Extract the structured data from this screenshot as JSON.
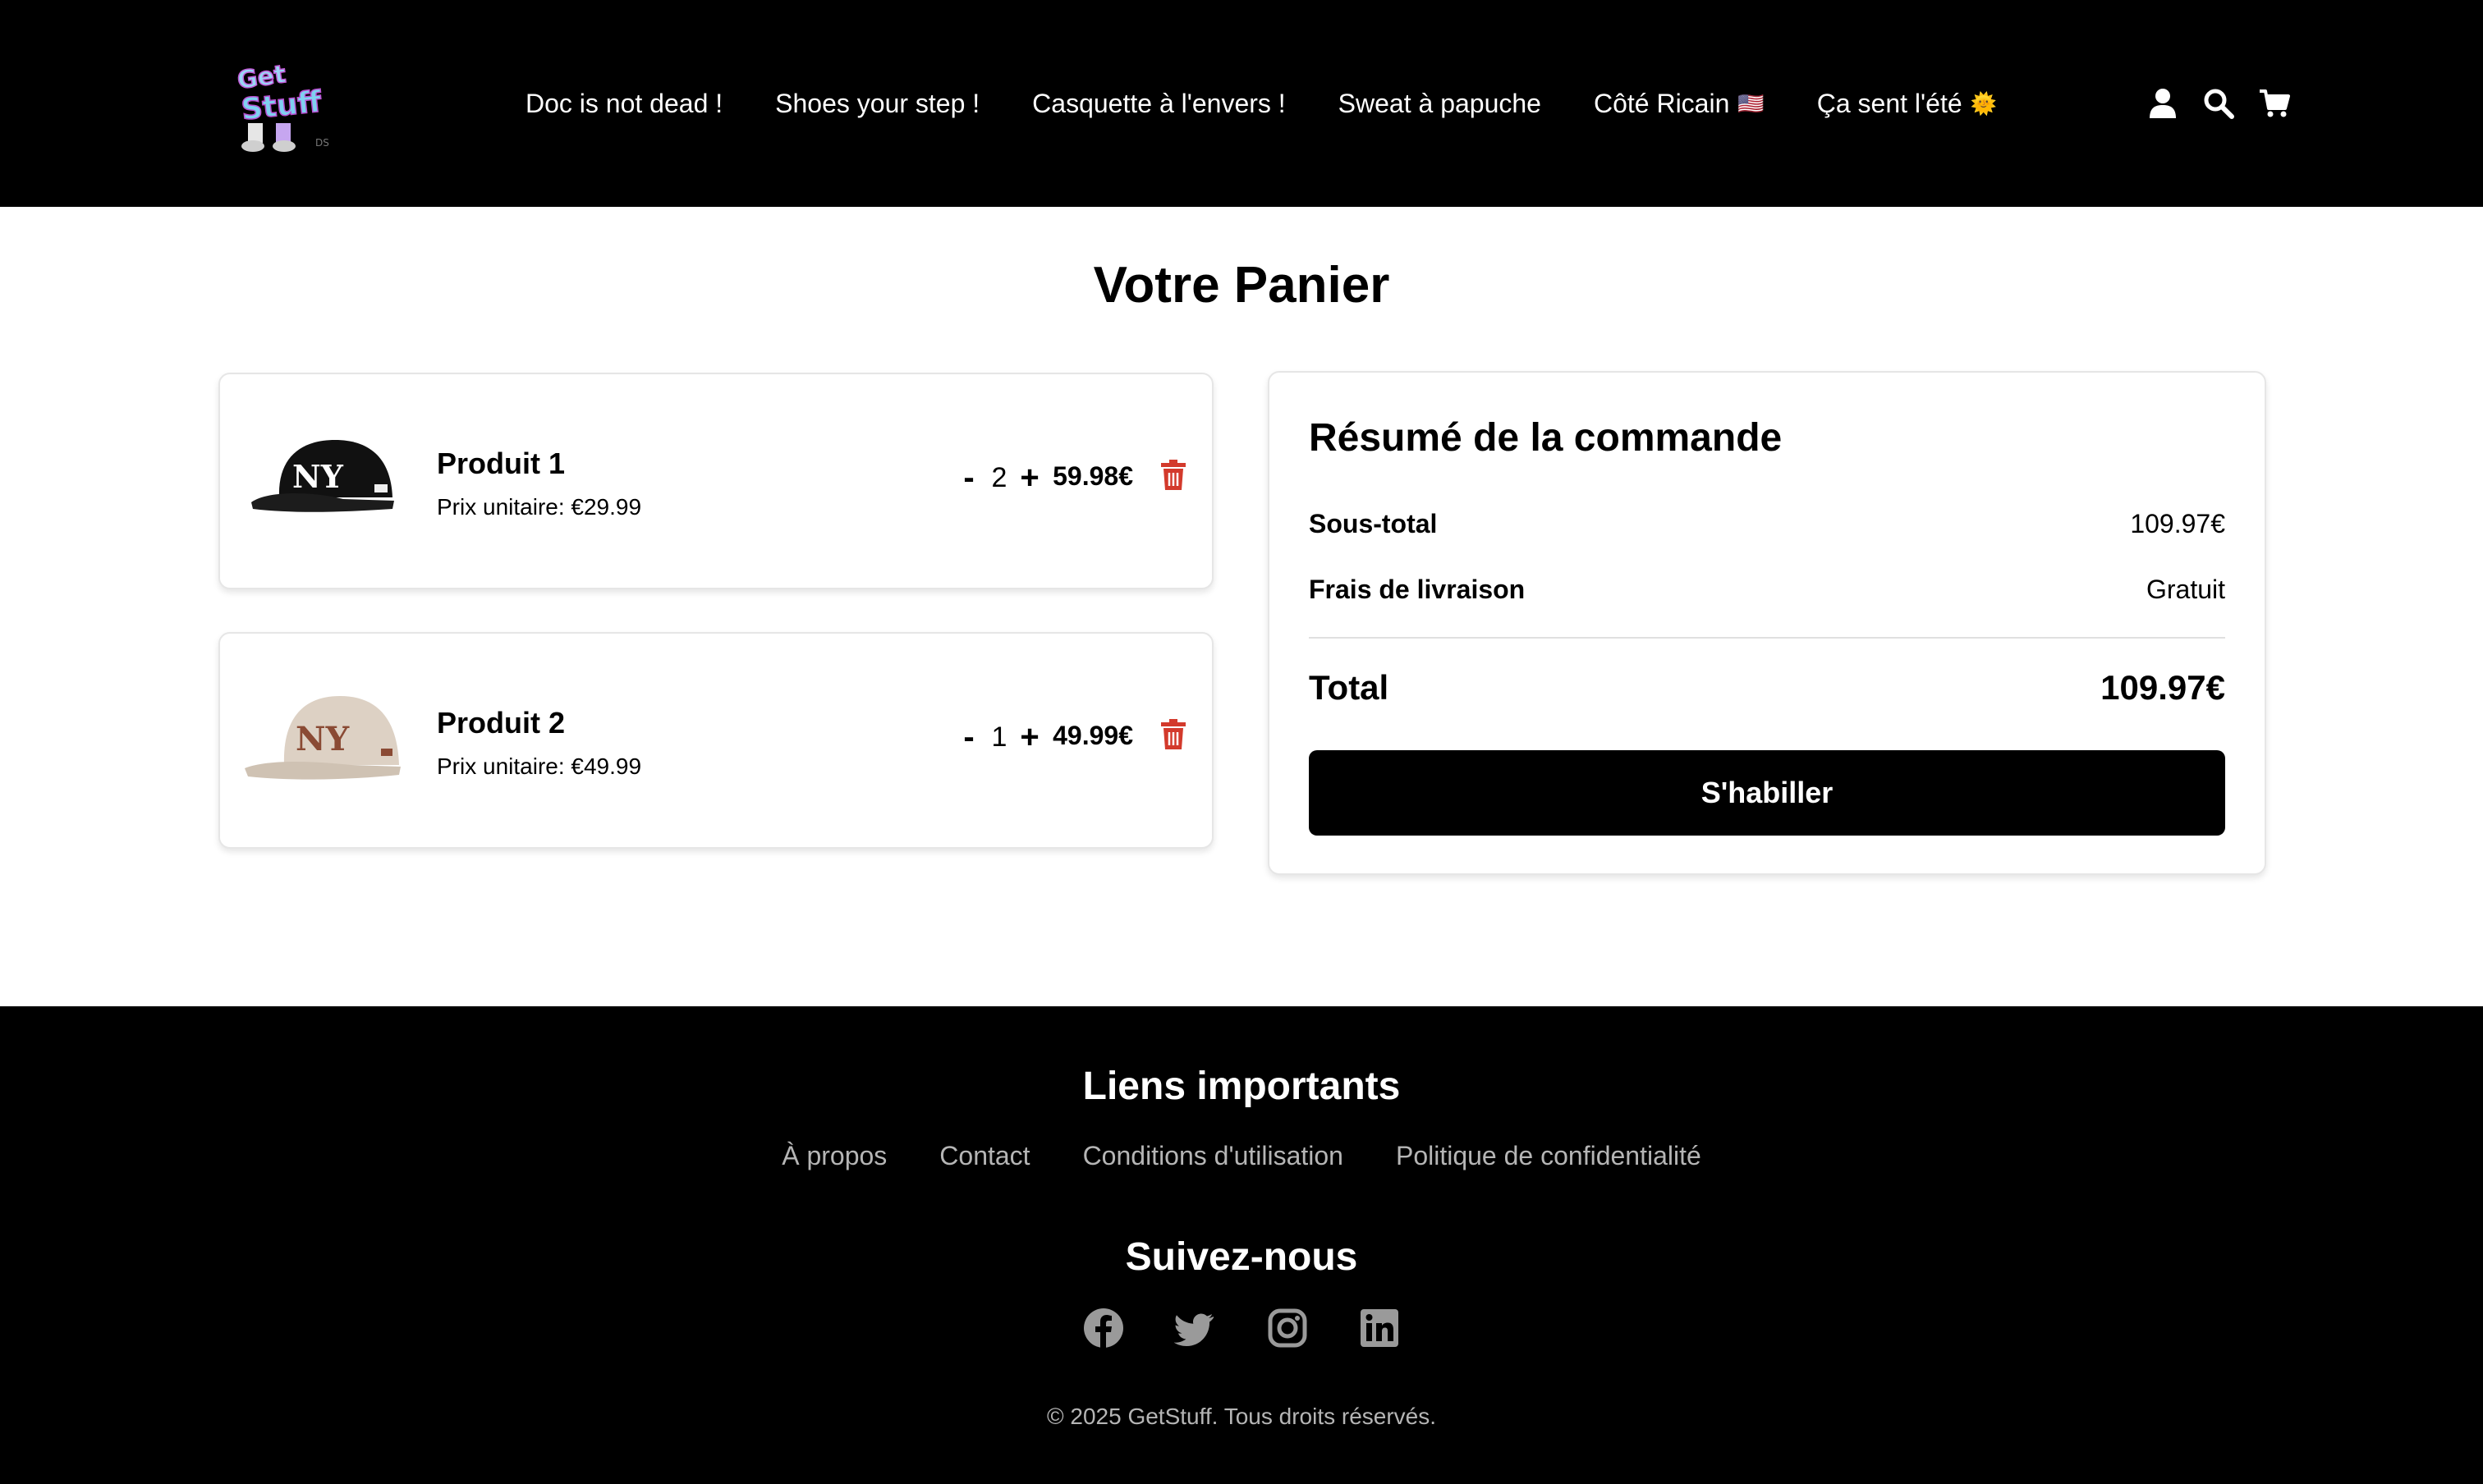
{
  "header": {
    "logo_alt": "GetStuff",
    "nav": [
      {
        "label": "Doc is not dead !",
        "emoji": ""
      },
      {
        "label": "Shoes your step !",
        "emoji": ""
      },
      {
        "label": "Casquette à l'envers !",
        "emoji": ""
      },
      {
        "label": "Sweat à papuche",
        "emoji": ""
      },
      {
        "label": "Côté Ricain",
        "emoji": "🇺🇸"
      },
      {
        "label": "Ça sent l'été",
        "emoji": "🌞"
      }
    ],
    "icons": [
      "user-icon",
      "search-icon",
      "cart-icon"
    ]
  },
  "main": {
    "title": "Votre Panier",
    "items": [
      {
        "name": "Produit 1",
        "unit_price": "Prix unitaire: €29.99",
        "minus": "-",
        "quantity": "2",
        "plus": "+",
        "line_total": "59.98€",
        "cap_color": "#111111",
        "logo_color": "#ffffff"
      },
      {
        "name": "Produit 2",
        "unit_price": "Prix unitaire: €49.99",
        "minus": "-",
        "quantity": "1",
        "plus": "+",
        "line_total": "49.99€",
        "cap_color": "#ddd1c4",
        "logo_color": "#8a4a34"
      }
    ]
  },
  "summary": {
    "title": "Résumé de la commande",
    "subtotal_label": "Sous-total",
    "subtotal_value": "109.97€",
    "shipping_label": "Frais de livraison",
    "shipping_value": "Gratuit",
    "total_label": "Total",
    "total_value": "109.97€",
    "cta": "S'habiller"
  },
  "footer": {
    "links_title": "Liens importants",
    "links": [
      "À propos",
      "Contact",
      "Conditions d'utilisation",
      "Politique de confidentialité"
    ],
    "follow_title": "Suivez-nous",
    "socials": [
      "facebook-icon",
      "twitter-icon",
      "instagram-icon",
      "linkedin-icon"
    ],
    "copyright": "© 2025 GetStuff. Tous droits réservés."
  },
  "colors": {
    "header_bg": "#000000",
    "footer_bg": "#000000",
    "trash": "#d33a2c",
    "footer_link": "#b5b5b5",
    "cta_bg": "#000000"
  }
}
